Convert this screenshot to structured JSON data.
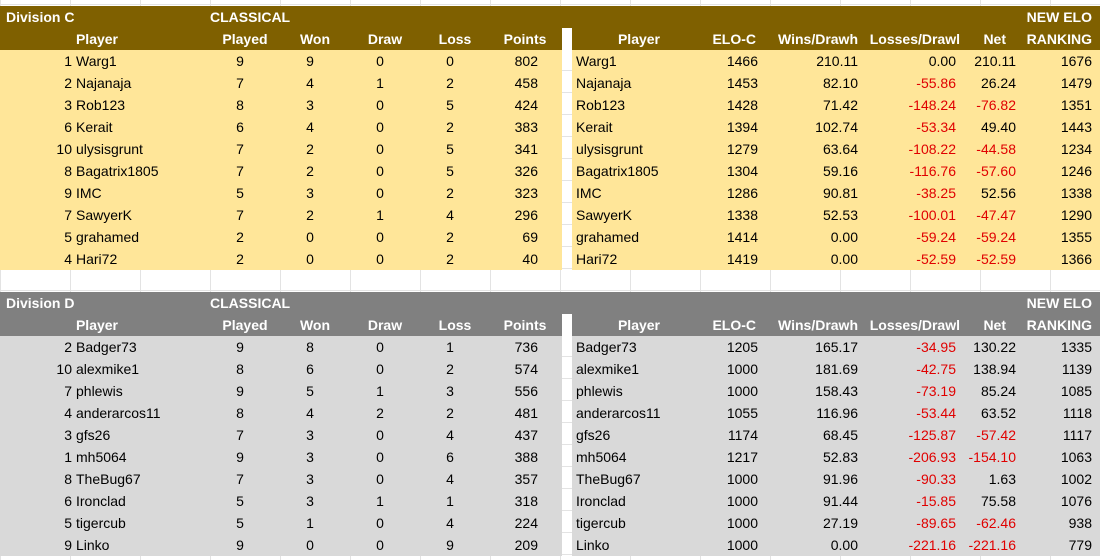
{
  "headers": {
    "player": "Player",
    "played": "Played",
    "won": "Won",
    "draw": "Draw",
    "loss": "Loss",
    "points": "Points",
    "elo": "ELO-C",
    "wins_drawh": "Wins/Drawh",
    "losses_drawl": "Losses/Drawl",
    "net": "Net",
    "new_elo": "NEW ELO",
    "ranking": "RANKING",
    "classical": "CLASSICAL"
  },
  "divisions": [
    {
      "name": "Division C",
      "rows": [
        {
          "rank": "1",
          "name": "Warg1",
          "played": "9",
          "won": "9",
          "draw": "0",
          "loss": "0",
          "points": "802",
          "elo": "1466",
          "wins": "210.11",
          "losses": "0.00",
          "net": "210.11",
          "new": "1676"
        },
        {
          "rank": "2",
          "name": "Najanaja",
          "played": "7",
          "won": "4",
          "draw": "1",
          "loss": "2",
          "points": "458",
          "elo": "1453",
          "wins": "82.10",
          "losses": "-55.86",
          "net": "26.24",
          "new": "1479"
        },
        {
          "rank": "3",
          "name": "Rob123",
          "played": "8",
          "won": "3",
          "draw": "0",
          "loss": "5",
          "points": "424",
          "elo": "1428",
          "wins": "71.42",
          "losses": "-148.24",
          "net": "-76.82",
          "new": "1351"
        },
        {
          "rank": "6",
          "name": "Kerait",
          "played": "6",
          "won": "4",
          "draw": "0",
          "loss": "2",
          "points": "383",
          "elo": "1394",
          "wins": "102.74",
          "losses": "-53.34",
          "net": "49.40",
          "new": "1443"
        },
        {
          "rank": "10",
          "name": "ulysisgrunt",
          "played": "7",
          "won": "2",
          "draw": "0",
          "loss": "5",
          "points": "341",
          "elo": "1279",
          "wins": "63.64",
          "losses": "-108.22",
          "net": "-44.58",
          "new": "1234"
        },
        {
          "rank": "8",
          "name": "Bagatrix1805",
          "played": "7",
          "won": "2",
          "draw": "0",
          "loss": "5",
          "points": "326",
          "elo": "1304",
          "wins": "59.16",
          "losses": "-116.76",
          "net": "-57.60",
          "new": "1246"
        },
        {
          "rank": "9",
          "name": "IMC",
          "played": "5",
          "won": "3",
          "draw": "0",
          "loss": "2",
          "points": "323",
          "elo": "1286",
          "wins": "90.81",
          "losses": "-38.25",
          "net": "52.56",
          "new": "1338"
        },
        {
          "rank": "7",
          "name": "SawyerK",
          "played": "7",
          "won": "2",
          "draw": "1",
          "loss": "4",
          "points": "296",
          "elo": "1338",
          "wins": "52.53",
          "losses": "-100.01",
          "net": "-47.47",
          "new": "1290"
        },
        {
          "rank": "5",
          "name": "grahamed",
          "played": "2",
          "won": "0",
          "draw": "0",
          "loss": "2",
          "points": "69",
          "elo": "1414",
          "wins": "0.00",
          "losses": "-59.24",
          "net": "-59.24",
          "new": "1355"
        },
        {
          "rank": "4",
          "name": "Hari72",
          "played": "2",
          "won": "0",
          "draw": "0",
          "loss": "2",
          "points": "40",
          "elo": "1419",
          "wins": "0.00",
          "losses": "-52.59",
          "net": "-52.59",
          "new": "1366"
        }
      ]
    },
    {
      "name": "Division D",
      "rows": [
        {
          "rank": "2",
          "name": "Badger73",
          "played": "9",
          "won": "8",
          "draw": "0",
          "loss": "1",
          "points": "736",
          "elo": "1205",
          "wins": "165.17",
          "losses": "-34.95",
          "net": "130.22",
          "new": "1335"
        },
        {
          "rank": "10",
          "name": "alexmike1",
          "played": "8",
          "won": "6",
          "draw": "0",
          "loss": "2",
          "points": "574",
          "elo": "1000",
          "wins": "181.69",
          "losses": "-42.75",
          "net": "138.94",
          "new": "1139"
        },
        {
          "rank": "7",
          "name": "phlewis",
          "played": "9",
          "won": "5",
          "draw": "1",
          "loss": "3",
          "points": "556",
          "elo": "1000",
          "wins": "158.43",
          "losses": "-73.19",
          "net": "85.24",
          "new": "1085"
        },
        {
          "rank": "4",
          "name": "anderarcos11",
          "played": "8",
          "won": "4",
          "draw": "2",
          "loss": "2",
          "points": "481",
          "elo": "1055",
          "wins": "116.96",
          "losses": "-53.44",
          "net": "63.52",
          "new": "1118"
        },
        {
          "rank": "3",
          "name": "gfs26",
          "played": "7",
          "won": "3",
          "draw": "0",
          "loss": "4",
          "points": "437",
          "elo": "1174",
          "wins": "68.45",
          "losses": "-125.87",
          "net": "-57.42",
          "new": "1117"
        },
        {
          "rank": "1",
          "name": "mh5064",
          "played": "9",
          "won": "3",
          "draw": "0",
          "loss": "6",
          "points": "388",
          "elo": "1217",
          "wins": "52.83",
          "losses": "-206.93",
          "net": "-154.10",
          "new": "1063"
        },
        {
          "rank": "8",
          "name": "TheBug67",
          "played": "7",
          "won": "3",
          "draw": "0",
          "loss": "4",
          "points": "357",
          "elo": "1000",
          "wins": "91.96",
          "losses": "-90.33",
          "net": "1.63",
          "new": "1002"
        },
        {
          "rank": "6",
          "name": "Ironclad",
          "played": "5",
          "won": "3",
          "draw": "1",
          "loss": "1",
          "points": "318",
          "elo": "1000",
          "wins": "91.44",
          "losses": "-15.85",
          "net": "75.58",
          "new": "1076"
        },
        {
          "rank": "5",
          "name": "tigercub",
          "played": "5",
          "won": "1",
          "draw": "0",
          "loss": "4",
          "points": "224",
          "elo": "1000",
          "wins": "27.19",
          "losses": "-89.65",
          "net": "-62.46",
          "new": "938"
        },
        {
          "rank": "9",
          "name": "Linko",
          "played": "9",
          "won": "0",
          "draw": "0",
          "loss": "9",
          "points": "209",
          "elo": "1000",
          "wins": "0.00",
          "losses": "-221.16",
          "net": "-221.16",
          "new": "779"
        }
      ]
    }
  ]
}
